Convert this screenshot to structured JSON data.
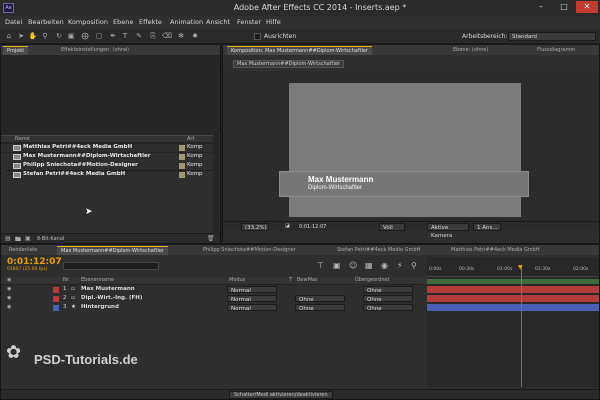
{
  "window": {
    "title": "Adobe After Effects CC 2014 - Inserts.aep *",
    "logo": "Ae"
  },
  "menu": [
    "Datei",
    "Bearbeiten",
    "Komposition",
    "Ebene",
    "Effekte",
    "Animation",
    "Ansicht",
    "Fenster",
    "Hilfe"
  ],
  "toolbar": {
    "ausrichten": "Ausrichten",
    "workspace_label": "Arbeitsbereich:",
    "workspace_value": "Standard"
  },
  "project": {
    "tab_project": "Projekt",
    "tab_effects": "Effekteinstellungen: (ohne)",
    "search_placeholder": "⌕▾",
    "col_name": "Name",
    "col_type": "Art",
    "items": [
      {
        "name": "Matthias Petri##4eck Media GmbH",
        "type": "Komp"
      },
      {
        "name": "Max Mustermann##Diplom-Wirtschaftler",
        "type": "Komp"
      },
      {
        "name": "Philipp Sniechota##Motion-Designer",
        "type": "Komp"
      },
      {
        "name": "Stefan Petri##4eck Media GmbH",
        "type": "Komp"
      }
    ],
    "bit_depth": "8-Bit-Kanal"
  },
  "comp": {
    "tab": "Komposition: Max Mustermann##Diplom-Wirtschaftler",
    "tab_layer": "Ebene: (ohne)",
    "tab_flow": "Flussdiagramm",
    "sub_tab": "Max Mustermann##Diplom-Wirtschaftler",
    "lower_third_name": "Max Mustermann",
    "lower_third_title": "Diplom-Wirtschaftler",
    "zoom": "(33,2%)",
    "timecode": "0:01:12:07",
    "resolution": "Voll",
    "camera": "Aktive Kamera",
    "views": "1 Ans..."
  },
  "timeline": {
    "tabs": [
      "Renderliste",
      "Max Mustermann##Diplom-Wirtschaftler",
      "Philipp Sniechota##Motion-Designer",
      "Stefan Petri##4eck Media GmbH",
      "Matthias Petri##4eck Media GmbH"
    ],
    "timecode": "0:01:12:07",
    "frames": "01807 (25.00 fps)",
    "col_nr": "Nr.",
    "col_name": "Ebenenname",
    "col_mode": "Modus",
    "col_t": "T",
    "col_bewmas": "BewMas",
    "col_parent": "Übergeordnet",
    "layers": [
      {
        "nr": "1",
        "name": "Max Mustermann",
        "mode": "Normal",
        "bewmas": "",
        "parent": "Ohne",
        "color": "#b53a3a"
      },
      {
        "nr": "2",
        "name": "Dipl.-Wirt.-Ing. (FH)",
        "mode": "Normal",
        "bewmas": "Ohne",
        "parent": "Ohne",
        "color": "#b53a3a"
      },
      {
        "nr": "3",
        "name": "Hintergrund",
        "mode": "Normal",
        "bewmas": "Ohne",
        "parent": "Ohne",
        "color": "#4a5fb5"
      }
    ],
    "ruler": [
      "0:00s",
      "00:30s",
      "01:00s",
      "01:30s",
      "02:00s"
    ],
    "footer_button": "Schalter/Modi aktivieren/deaktivieren"
  },
  "watermark": "PSD-Tutorials.de",
  "colors": {
    "accent": "#e8a100",
    "layer_red": "#b53a3a",
    "layer_blue": "#4a5fb5",
    "track_green": "#3f6b3a"
  }
}
